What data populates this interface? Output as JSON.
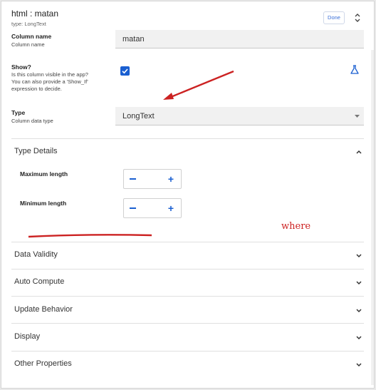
{
  "header": {
    "title": "html : matan",
    "subtitle": "type: LongText",
    "done_label": "Done"
  },
  "column_name": {
    "label": "Column name",
    "sublabel": "Column name",
    "value": "matan"
  },
  "show": {
    "label": "Show?",
    "help_lines": [
      "Is this column visible in the app?",
      "You can also provide a 'Show_If'",
      "expression to decide."
    ],
    "checked": true
  },
  "type": {
    "label": "Type",
    "sublabel": "Column data type",
    "value": "LongText"
  },
  "type_details": {
    "title": "Type Details",
    "max_label": "Maximum length",
    "min_label": "Minimum length",
    "minus": "−",
    "plus": "+"
  },
  "sections": [
    "Data Validity",
    "Auto Compute",
    "Update Behavior",
    "Display",
    "Other Properties"
  ],
  "annotation": {
    "text": "where",
    "color": "#cc2222"
  }
}
